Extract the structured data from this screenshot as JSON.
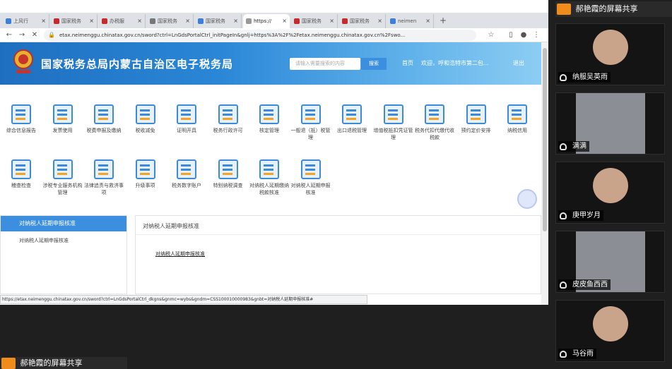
{
  "browser": {
    "tabs": [
      {
        "label": "上风行",
        "color": "#3d7fd6"
      },
      {
        "label": "国家税务",
        "color": "#c62a2a"
      },
      {
        "label": "办税服",
        "color": "#c62a2a"
      },
      {
        "label": "国家税务",
        "color": "#777777"
      },
      {
        "label": "国家税务",
        "color": "#3d7fd6"
      },
      {
        "label": "https://",
        "color": "#999999"
      },
      {
        "label": "国家税务",
        "color": "#c62a2a"
      },
      {
        "label": "国家税务",
        "color": "#c62a2a"
      },
      {
        "label": "neimen",
        "color": "#3d7fd6"
      }
    ],
    "url": "etax.neimenggu.chinatax.gov.cn/sword?ctrl=LnGdsPortalCtrl_initPageIn&gnlj=https%3A%2F%2Fetax.neimenggu.chinatax.gov.cn%2Fswo...",
    "status_url": "https://etax.neimenggu.chinatax.gov.cn/sword?ctrl=LnGdsPortalCtrl_dkgns&gnmc=wybs&gndm=CSS100010000983&gnbt=对纳税人延期申报核准#"
  },
  "site": {
    "title": "国家税务总局内蒙古自治区电子税务局",
    "search_placeholder": "请输入需要搜索的内容",
    "search_button": "搜索",
    "home": "首页",
    "welcome": "欢迎，呼和浩特市第二包...",
    "logout": "退出"
  },
  "services": [
    [
      "综合信息报告",
      "发票使用",
      "税费申报及缴纳",
      "税收减免",
      "证明开具",
      "税务行政许可",
      "核定管理",
      "一般退（抵）税管理",
      "出口退税管理",
      "增值税抵扣凭证管理",
      "税务代扣代缴代收税款",
      "预约定价安排",
      "纳税信用"
    ],
    [
      "稽查检查",
      "涉税专业服务机构管理",
      "法律追责与救济事项",
      "升级事项",
      "税务数字账户",
      "特别纳税调查",
      "对纳税人延期缴纳税款核准",
      "对纳税人延期申报核准"
    ]
  ],
  "left_panel": {
    "header": "对纳税人延期申报核准",
    "item": "对纳税人延期申报核准"
  },
  "right_panel": {
    "header": "对纳税人延期申报核准",
    "item": "对纳税人延期申报核准"
  },
  "meeting": {
    "share_label": "郝艳霞的屏幕共享",
    "participants": [
      "纳服吴英雨",
      "满满",
      "庚甲岁月",
      "皮皮鱼西西",
      "马谷雨"
    ]
  }
}
